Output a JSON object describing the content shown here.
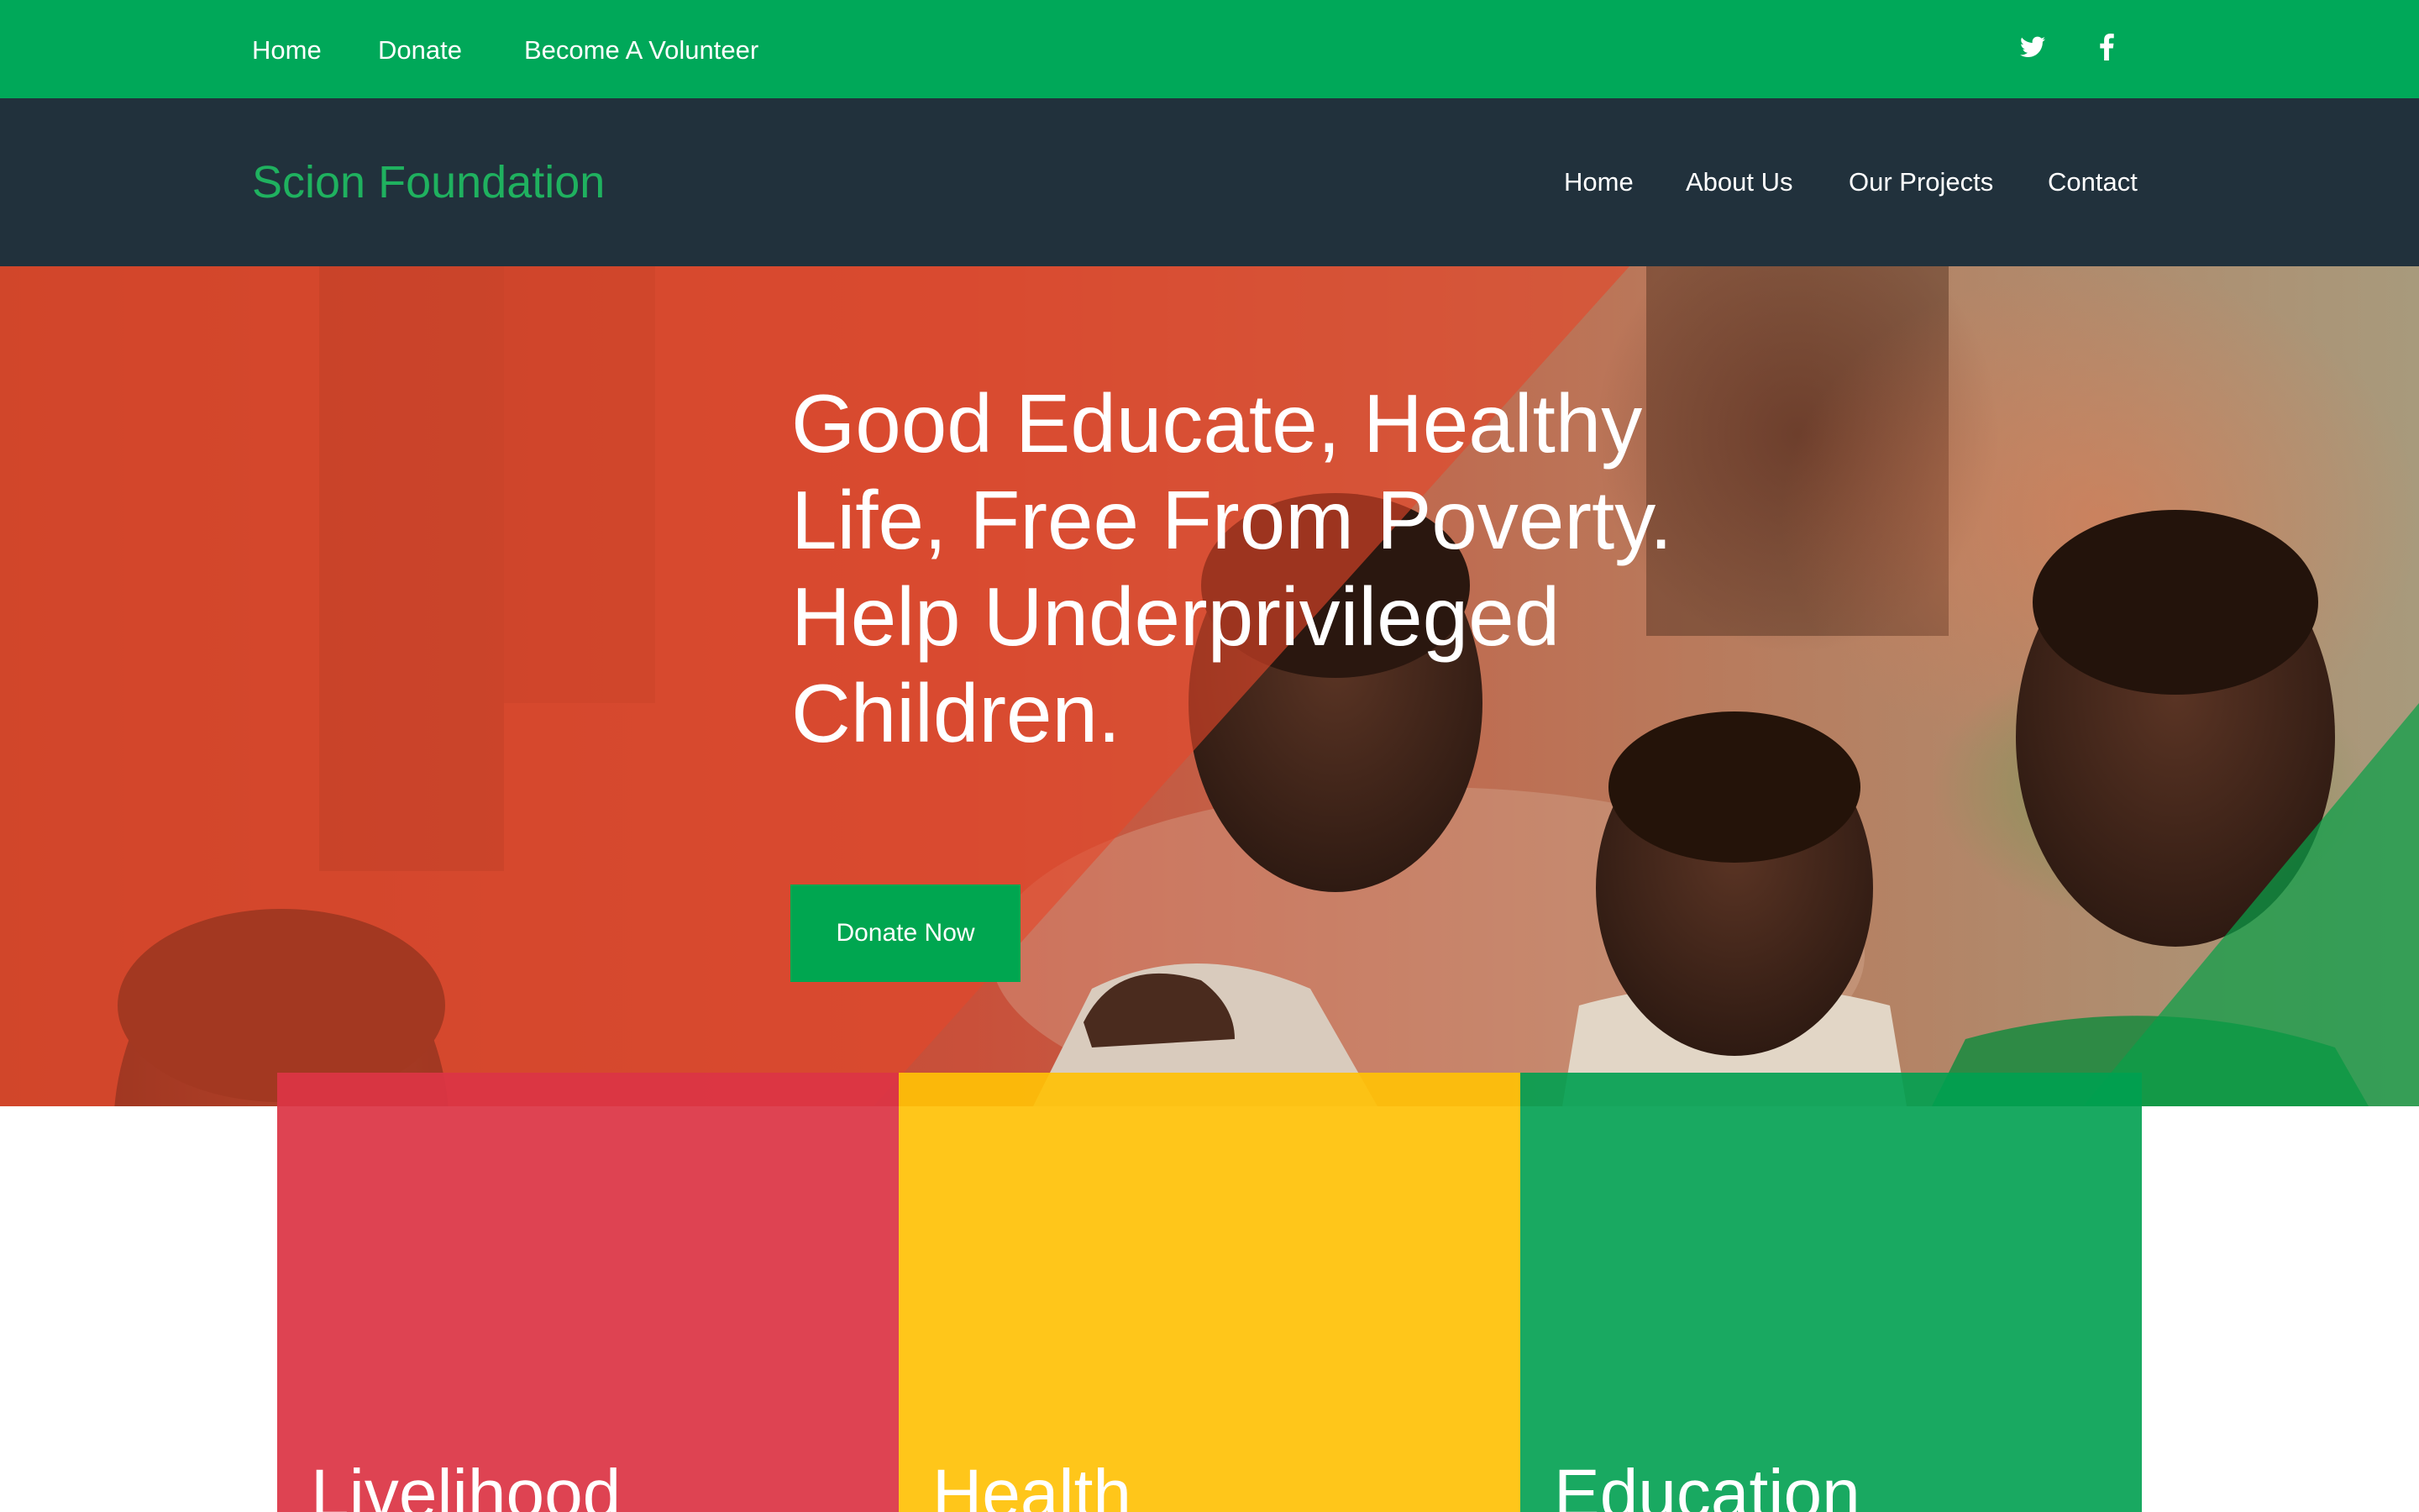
{
  "topbar": {
    "links": [
      {
        "label": "Home"
      },
      {
        "label": "Donate"
      },
      {
        "label": "Become A Volunteer"
      }
    ],
    "social": [
      "twitter-icon",
      "facebook-icon"
    ],
    "background": "#00a859"
  },
  "header": {
    "brand": "Scion Foundation",
    "brand_color": "#1fb15f",
    "background": "#21313c",
    "nav": [
      {
        "label": "Home"
      },
      {
        "label": "About Us"
      },
      {
        "label": "Our Projects"
      },
      {
        "label": "Contact"
      }
    ]
  },
  "hero": {
    "title": "Good Educate, Healthy Life, Free From Poverty. Help Underprivileged Children.",
    "cta_label": "Donate Now",
    "cta_color": "#00a650"
  },
  "causes": [
    {
      "title": "Livelihood",
      "color": "#dc3545"
    },
    {
      "title": "Health",
      "color": "#ffc107"
    },
    {
      "title": "Education",
      "color": "#00a050"
    }
  ]
}
